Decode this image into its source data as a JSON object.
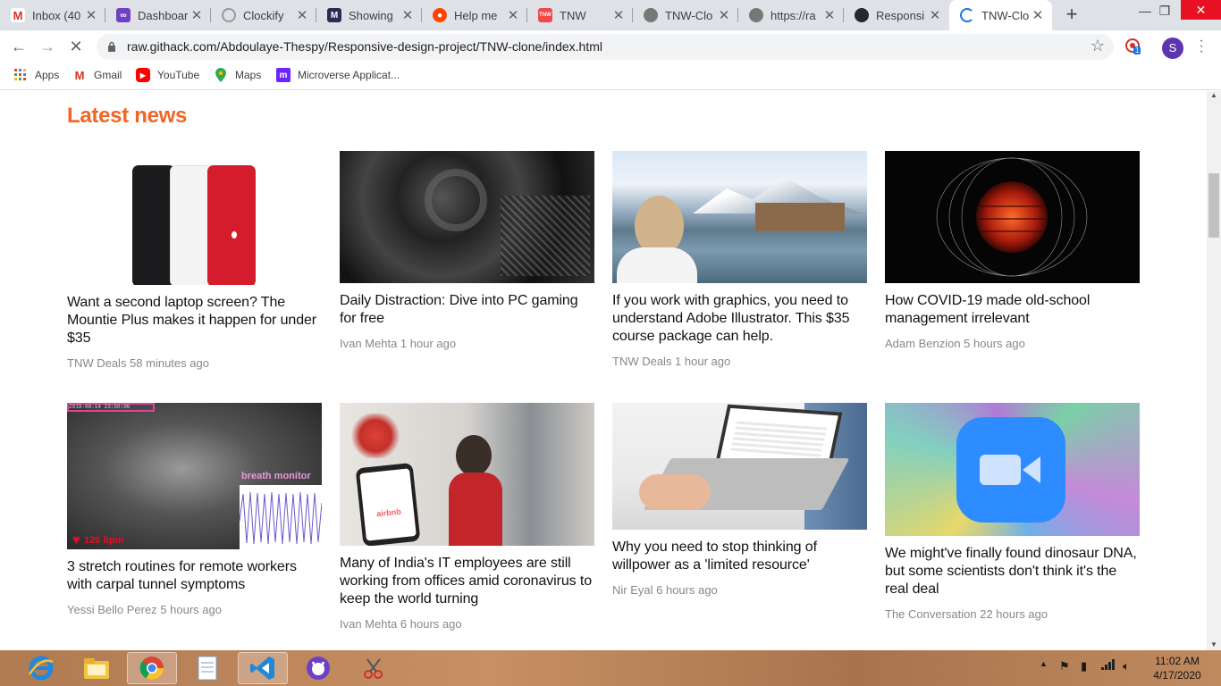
{
  "browser": {
    "tabs": [
      {
        "title": "Inbox (40",
        "icon": "gmail-icon"
      },
      {
        "title": "Dashboar",
        "icon": "dashboard-icon"
      },
      {
        "title": "Clockify",
        "icon": "clockify-icon"
      },
      {
        "title": "Showing",
        "icon": "showing-icon"
      },
      {
        "title": "Help me",
        "icon": "reddit-icon"
      },
      {
        "title": "TNW",
        "icon": "tnw-icon"
      },
      {
        "title": "TNW-Clo",
        "icon": "globe-icon"
      },
      {
        "title": "https://ra",
        "icon": "globe-icon"
      },
      {
        "title": "Responsi",
        "icon": "github-icon"
      },
      {
        "title": "TNW-Clo",
        "icon": "loading-icon"
      }
    ],
    "active_tab_index": 9,
    "url": "raw.githack.com/Abdoulaye-Thespy/Responsive-design-project/TNW-clone/index.html",
    "profile_initial": "S",
    "extension_badge": "1",
    "bookmarks": [
      {
        "label": "Apps",
        "icon": "apps-grid-icon"
      },
      {
        "label": "Gmail",
        "icon": "gmail-icon"
      },
      {
        "label": "YouTube",
        "icon": "youtube-icon"
      },
      {
        "label": "Maps",
        "icon": "maps-pin-icon"
      },
      {
        "label": "Microverse Applicat...",
        "icon": "microverse-icon"
      }
    ]
  },
  "page": {
    "section_title": "Latest news",
    "articles": [
      {
        "title": "Want a second laptop screen? The Mountie Plus makes it happen for under $35",
        "meta": "TNW Deals 58 minutes ago",
        "image": "iphone-photo"
      },
      {
        "title": "Daily Distraction: Dive into PC gaming for free",
        "meta": "Ivan Mehta 1 hour ago",
        "image": "tunnel-photo"
      },
      {
        "title": "If you work with graphics, you need to understand Adobe Illustrator. This $35 course package can help.",
        "meta": "TNW Deals 1 hour ago",
        "image": "illustration-photo"
      },
      {
        "title": "How COVID-19 made old-school management irrelevant",
        "meta": "Adam Benzion 5 hours ago",
        "image": "planet-photo"
      },
      {
        "title": "3 stretch routines for remote workers with carpal tunnel symptoms",
        "meta": "Yessi Bello Perez 5 hours ago",
        "image": "baby-monitor-photo",
        "overlay_label": "breath monitor",
        "overlay_bpm": "126 bpm",
        "overlay_timestamp": "2019-08-14 23:50:06"
      },
      {
        "title": "Many of India's IT employees are still working from offices amid coronavirus to keep the world turning",
        "meta": "Ivan Mehta 6 hours ago",
        "image": "airbnb-phone-photo",
        "overlay_brand": "airbnb"
      },
      {
        "title": "Why you need to stop thinking of willpower as a 'limited resource'",
        "meta": "Nir Eyal 6 hours ago",
        "image": "laptop-typing-photo"
      },
      {
        "title": "We might've finally found dinosaur DNA, but some scientists don't think it's the real deal",
        "meta": "The Conversation 22 hours ago",
        "image": "zoom-logo-photo"
      }
    ]
  },
  "taskbar": {
    "apps": [
      "ie-icon",
      "explorer-icon",
      "chrome-icon",
      "notepad-icon",
      "vscode-icon",
      "github-desktop-icon",
      "snipping-tool-icon"
    ],
    "time": "11:02 AM",
    "date": "4/17/2020"
  },
  "colors": {
    "accent": "#f26522",
    "tab_strip": "#dee1e6",
    "close_button": "#e81123"
  }
}
